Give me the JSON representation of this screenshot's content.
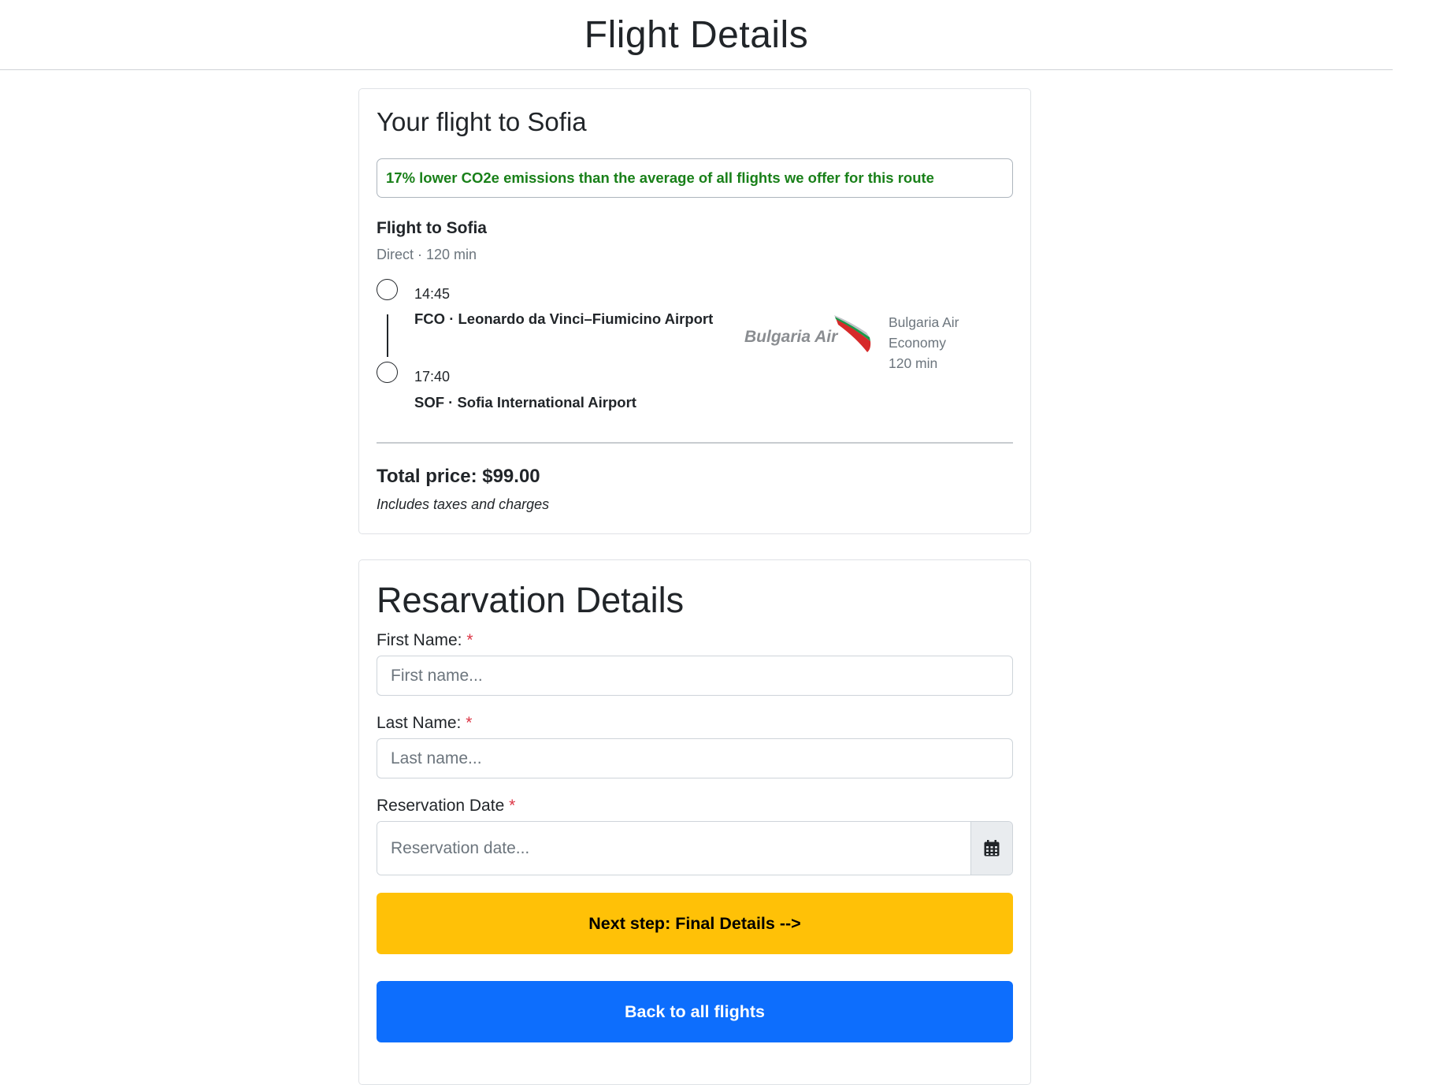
{
  "header": {
    "title": "Flight Details"
  },
  "flight_card": {
    "heading": "Your flight to Sofia",
    "co2_note": "17% lower CO2e emissions than the average of all flights we offer for this route",
    "subtitle": "Flight to Sofia",
    "meta": "Direct · 120 min",
    "departure": {
      "time": "14:45",
      "airport": "FCO · Leonardo da Vinci–Fiumicino Airport"
    },
    "arrival": {
      "time": "17:40",
      "airport": "SOF · Sofia International Airport"
    },
    "airline": {
      "logo_text": "Bulgaria Air",
      "name": "Bulgaria Air",
      "cabin": "Economy",
      "duration": "120 min",
      "logo_colors": [
        "#8a8d91",
        "#ffffff",
        "#1a9a4a",
        "#d62a2a"
      ]
    },
    "price": {
      "total": "Total price: $99.00",
      "note": "Includes taxes and charges"
    },
    "accent_color": "#198019"
  },
  "reservation": {
    "title": "Resarvation Details",
    "first_name": {
      "label": "First Name:",
      "required_mark": "*",
      "placeholder": "First name...",
      "value": ""
    },
    "last_name": {
      "label": "Last Name:",
      "required_mark": "*",
      "placeholder": "Last name...",
      "value": ""
    },
    "date": {
      "label": "Reservation Date",
      "required_mark": "*",
      "placeholder": "Reservation date...",
      "value": "",
      "icon": "calendar-icon"
    },
    "next_button": "Next step: Final Details -->",
    "back_button": "Back to all flights",
    "colors": {
      "next": "#ffc107",
      "back": "#0d6efd",
      "required": "#dc3545"
    }
  }
}
